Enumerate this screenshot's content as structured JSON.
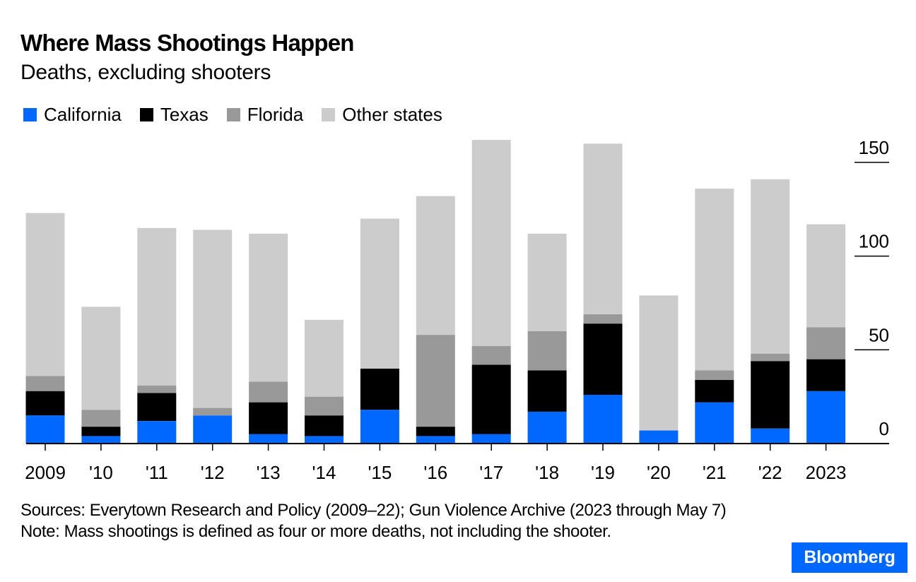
{
  "header": {
    "title": "Where Mass Shootings Happen",
    "subtitle": "Deaths, excluding shooters"
  },
  "legend": [
    {
      "label": "California",
      "color": "#0068ff"
    },
    {
      "label": "Texas",
      "color": "#000000"
    },
    {
      "label": "Florida",
      "color": "#999999"
    },
    {
      "label": "Other states",
      "color": "#cccccc"
    }
  ],
  "chart_data": {
    "type": "bar",
    "stacked": true,
    "title": "Where Mass Shootings Happen",
    "subtitle": "Deaths, excluding shooters",
    "xlabel": "",
    "ylabel": "",
    "ylim": [
      0,
      165
    ],
    "y_ticks": [
      0,
      50,
      100,
      150
    ],
    "y_axis_position": "right",
    "grid": false,
    "legend_position": "top-left",
    "categories": [
      "2009",
      "'10",
      "'11",
      "'12",
      "'13",
      "'14",
      "'15",
      "'16",
      "'17",
      "'18",
      "'19",
      "'20",
      "'21",
      "'22",
      "2023"
    ],
    "series": [
      {
        "name": "California",
        "color": "#0068ff",
        "values": [
          15,
          4,
          12,
          15,
          5,
          4,
          18,
          4,
          5,
          17,
          26,
          7,
          22,
          8,
          28
        ]
      },
      {
        "name": "Texas",
        "color": "#000000",
        "values": [
          13,
          5,
          15,
          0,
          17,
          11,
          22,
          5,
          37,
          22,
          38,
          0,
          12,
          36,
          17
        ]
      },
      {
        "name": "Florida",
        "color": "#999999",
        "values": [
          8,
          9,
          4,
          4,
          11,
          10,
          0,
          49,
          10,
          21,
          5,
          0,
          5,
          4,
          17
        ]
      },
      {
        "name": "Other states",
        "color": "#cccccc",
        "values": [
          87,
          55,
          84,
          95,
          79,
          41,
          80,
          74,
          110,
          52,
          91,
          72,
          97,
          93,
          55
        ]
      }
    ]
  },
  "footer": {
    "sources": "Sources: Everytown Research and Policy (2009–22); Gun Violence Archive (2023 through May 7)",
    "note": "Note: Mass shootings is defined as four or more deaths, not including the shooter."
  },
  "brand": {
    "label": "Bloomberg",
    "color": "#0068ff"
  }
}
